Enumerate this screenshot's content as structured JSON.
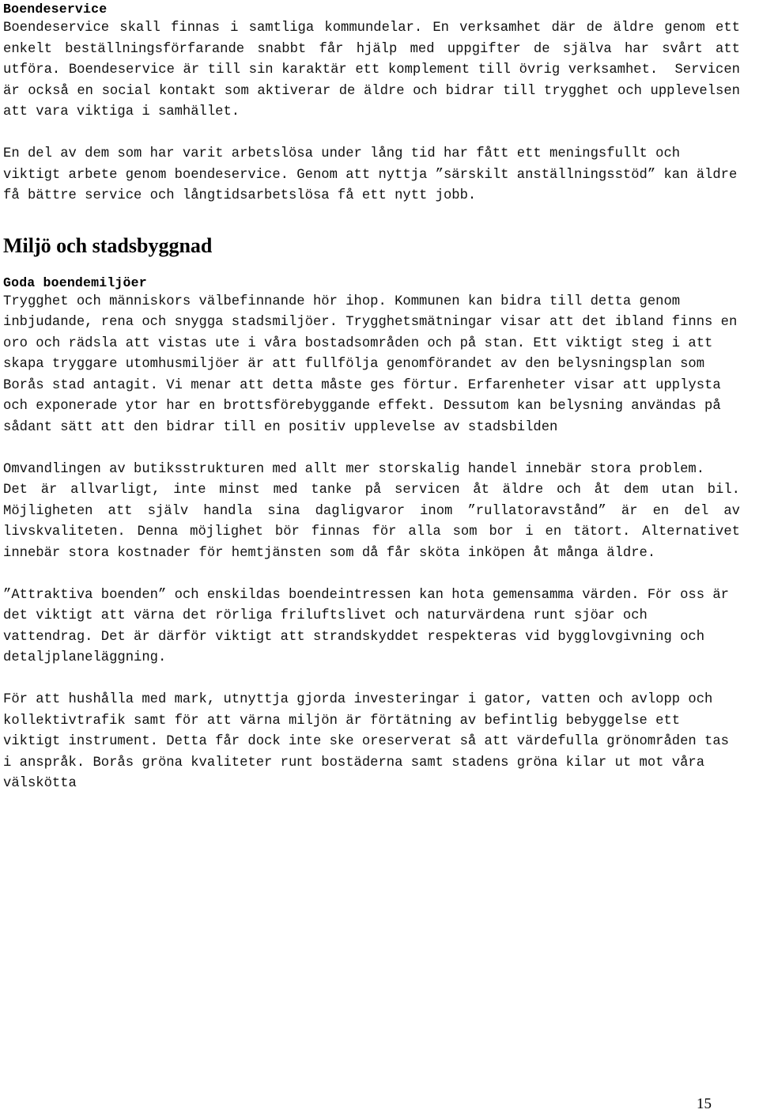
{
  "document": {
    "page_number": "15",
    "sections": [
      {
        "heading": "Boendeservice",
        "heading_style": "mono-bold",
        "paragraphs": [
          "Boendeservice skall finnas i samtliga kommundelar. En verksamhet där de äldre genom ett enkelt beställningsförfarande snabbt får hjälp med uppgifter de själva har svårt att utföra. Boendeservice är till sin karaktär ett komplement till övrig verksamhet.  Servicen är också en social kontakt som aktiverar de äldre och bidrar till trygghet och upplevelsen att vara viktiga i samhället.",
          "En del av dem som har varit arbetslösa under lång tid har fått ett meningsfullt och viktigt arbete genom boendeservice. Genom att nyttja ”särskilt anställningsstöd” kan äldre få bättre service och långtidsarbetslösa få ett nytt jobb."
        ]
      },
      {
        "heading": "Miljö och stadsbyggnad",
        "heading_style": "serif-bold",
        "subheading": "Goda boendemiljöer",
        "paragraphs": [
          "Trygghet och människors välbefinnande hör ihop. Kommunen kan bidra till detta genom inbjudande, rena och snygga stadsmiljöer. Trygghetsmätningar visar att det ibland finns en oro och rädsla att vistas ute i våra bostadsområden och på stan. Ett viktigt steg i att skapa tryggare utomhusmiljöer är att fullfölja genomförandet av den belysningsplan som Borås stad antagit. Vi menar att detta måste ges förtur. Erfarenheter visar att upplysta och exponerade ytor har en brottsförebyggande effekt. Dessutom kan belysning användas på sådant sätt att den bidrar till en positiv upplevelse av stadsbilden",
          "Omvandlingen av butiksstrukturen med allt mer storskalig handel innebär stora problem.",
          "Det är allvarligt, inte minst med tanke på servicen åt äldre och åt dem utan bil. Möjligheten att själv handla sina dagligvaror inom ”rullatoravstånd” är en del av livskvaliteten. Denna möjlighet bör finnas för alla som bor i en tätort. Alternativet innebär stora kostnader för hemtjänsten som då får sköta inköpen åt många äldre.",
          "”Attraktiva boenden” och enskildas boendeintressen kan hota gemensamma värden. För oss är det viktigt att värna det rörliga friluftslivet och naturvärdena runt sjöar och vattendrag. Det är därför viktigt att strandskyddet respekteras vid bygglovgivning och detaljplaneläggning.",
          "För att hushålla med mark, utnyttja gjorda investeringar i gator, vatten och avlopp och kollektivtrafik samt för att värna miljön är förtätning av befintlig bebyggelse ett viktigt instrument. Detta får dock inte ske oreserverat så att värdefulla grönområden tas i anspråk. Borås gröna kvaliteter runt bostäderna samt stadens gröna kilar ut mot våra välskötta"
        ]
      }
    ]
  }
}
